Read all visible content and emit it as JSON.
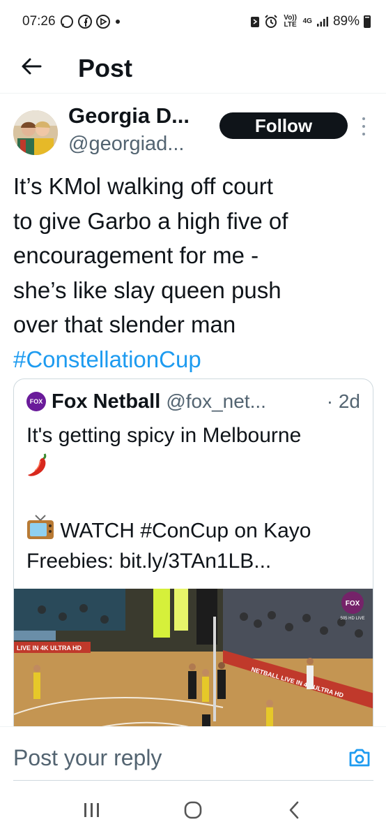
{
  "status_bar": {
    "time": "07:26",
    "network": "4G",
    "volte": "Vo)) LTE",
    "battery": "89%"
  },
  "header": {
    "title": "Post"
  },
  "tweet": {
    "display_name": "Georgia D...",
    "handle": "@georgiad...",
    "follow_label": "Follow",
    "text_lines": [
      "It’s KMol walking off court",
      "to give Garbo a high five of",
      "encouragement for me -",
      "she’s like slay queen push",
      "over that slender man"
    ],
    "hashtag": "#ConstellationCup"
  },
  "quote": {
    "avatar_text": "FOX",
    "name": "Fox Netball",
    "handle": "@fox_net...",
    "time": "· 2d",
    "line1": "It's getting spicy in Melbourne",
    "line3": "WATCH #ConCup on Kayo",
    "line4": "Freebies: bit.ly/3TAn1LB...",
    "media": {
      "banner_left": "LIVE IN 4K ULTRA HD",
      "banner_right": "NETBALL LIVE IN 4K ULTRA HD",
      "fox_logo": "FOX",
      "fox_sub": "505 HD LIVE"
    }
  },
  "reply": {
    "placeholder": "Post your reply"
  },
  "icons": {
    "back": "arrow-left-icon",
    "camera": "camera-icon",
    "recents": "recent-apps-icon",
    "home": "home-icon",
    "nav_back": "chevron-left-icon"
  },
  "colors": {
    "accent": "#1d9bf0",
    "text": "#0f1419",
    "secondary": "#536471",
    "follow_bg": "#0f1419"
  }
}
